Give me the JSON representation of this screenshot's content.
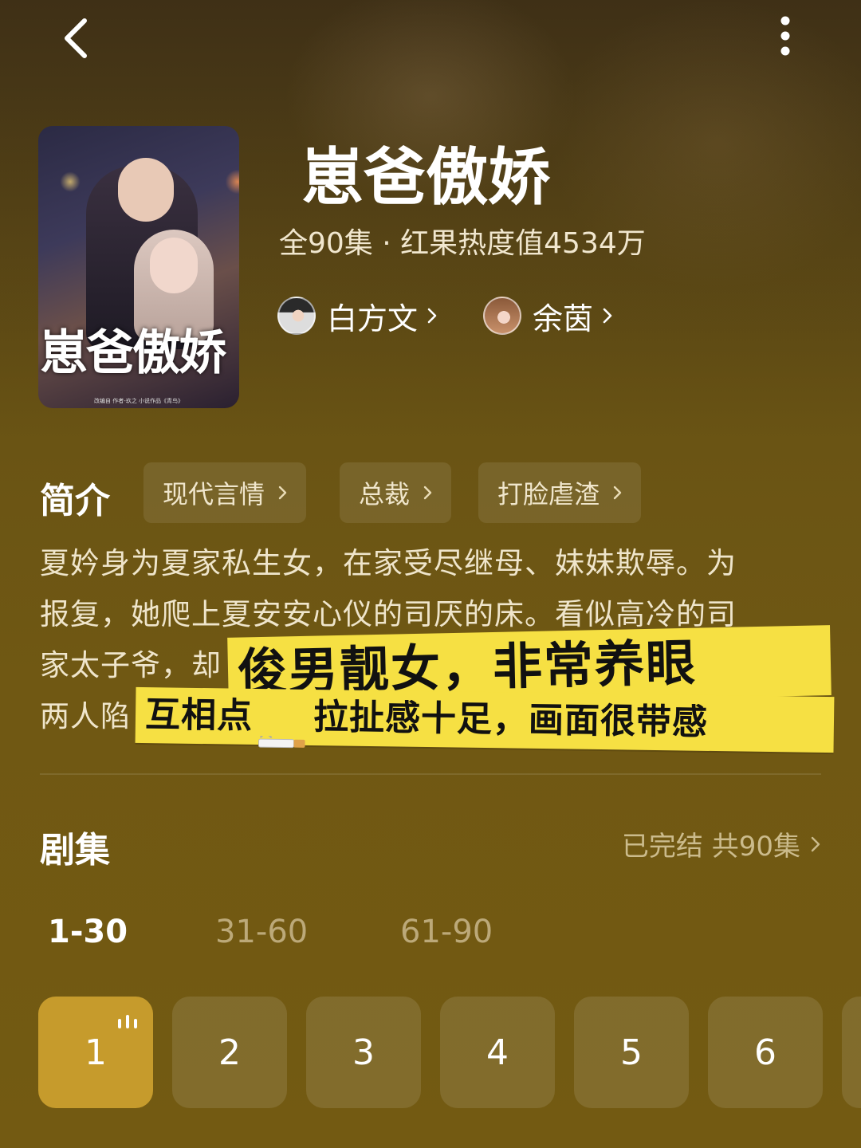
{
  "show": {
    "title": "崽爸傲娇",
    "meta": "全90集 · 红果热度值4534万",
    "poster_title": "崽爸傲娇",
    "poster_credits": "改编自 作者-玖之 小说作品《青鸟》"
  },
  "cast": [
    {
      "name": "白方文",
      "avatar_icon": "actor-avatar"
    },
    {
      "name": "余茵",
      "avatar_icon": "actress-avatar"
    }
  ],
  "intro": {
    "title": "简介",
    "tags": [
      "现代言情",
      "总裁",
      "打脸虐渣"
    ],
    "synopsis_lines": [
      "夏妗身为夏家私生女，在家受尽继母、妹妹欺辱。为",
      "报复，她爬上夏安安心仪的司厌的床。看似高冷的司",
      "家太子爷，却",
      "两人陷"
    ]
  },
  "overlay": {
    "line1": "俊男靓女，非常养眼",
    "line2_a": "互相点",
    "line2_b": "拉扯感十足，画面很带感"
  },
  "episodes": {
    "title": "剧集",
    "status": "已完结 共90集",
    "ranges": [
      "1-30",
      "31-60",
      "61-90"
    ],
    "active_range": "1-30",
    "items": [
      "1",
      "2",
      "3",
      "4",
      "5",
      "6"
    ],
    "active_item": "1"
  },
  "colors": {
    "accent": "#c69b2c",
    "highlight": "#f6e043",
    "background": "#6a5414"
  },
  "icons": {
    "back": "back-arrow-icon",
    "more": "more-vertical-icon",
    "chevron": "chevron-right-icon",
    "playing": "playing-bars-icon",
    "cigarette": "cigarette-emoji-icon"
  }
}
